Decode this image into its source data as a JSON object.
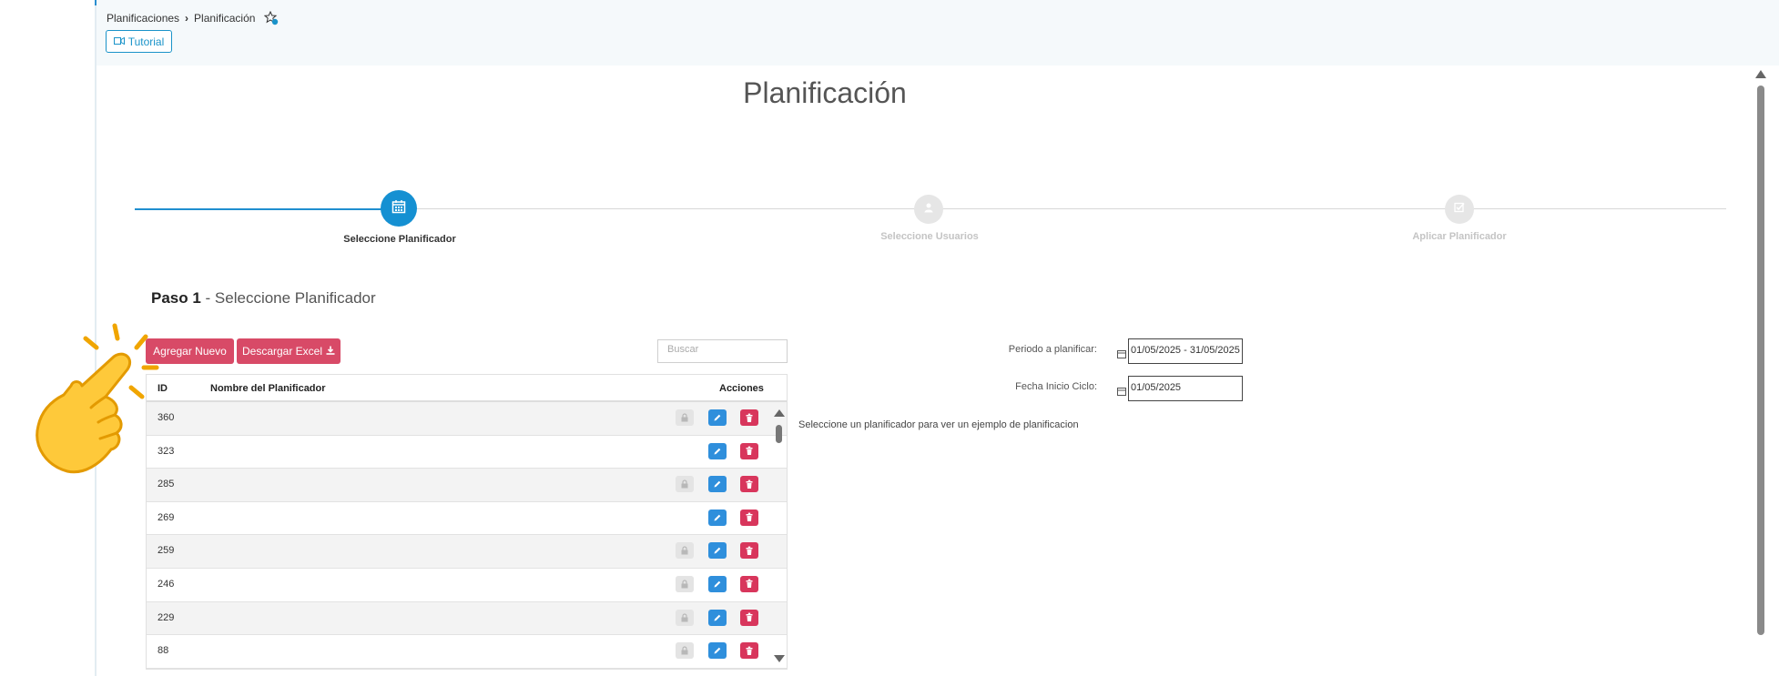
{
  "breadcrumb": {
    "parent": "Planificaciones",
    "current": "Planificación"
  },
  "tutorial_label": "Tutorial",
  "page_title": "Planificación",
  "steps": [
    {
      "label": "Seleccione Planificador",
      "state": "active",
      "icon": "calendar-icon"
    },
    {
      "label": "Seleccione Usuarios",
      "state": "inactive",
      "icon": "user-icon"
    },
    {
      "label": "Aplicar Planificador",
      "state": "inactive",
      "icon": "check-square-icon"
    }
  ],
  "paso": {
    "prefix": "Paso 1",
    "rest": " - Seleccione Planificador"
  },
  "buttons": {
    "add_new": "Agregar Nuevo",
    "download_excel": "Descargar Excel"
  },
  "search": {
    "placeholder": "Buscar"
  },
  "table": {
    "headers": {
      "id": "ID",
      "name": "Nombre del Planificador",
      "actions": "Acciones"
    },
    "rows": [
      {
        "id": "360",
        "name": "",
        "locked": true
      },
      {
        "id": "323",
        "name": "",
        "locked": false
      },
      {
        "id": "285",
        "name": "",
        "locked": true
      },
      {
        "id": "269",
        "name": "",
        "locked": false
      },
      {
        "id": "259",
        "name": "",
        "locked": true
      },
      {
        "id": "246",
        "name": "",
        "locked": true
      },
      {
        "id": "229",
        "name": "",
        "locked": true
      },
      {
        "id": "88",
        "name": "",
        "locked": true
      }
    ]
  },
  "form": {
    "periodo_label": "Periodo a planificar:",
    "periodo_value": "01/05/2025 - 31/05/2025",
    "fecha_label": "Fecha Inicio Ciclo:",
    "fecha_value": "01/05/2025"
  },
  "hint": "Seleccione un planificador para ver un ejemplo de planificacion",
  "colors": {
    "accent": "#1590d2",
    "danger": "#d84a67",
    "edit": "#2f8fdc",
    "delete": "#d8365c"
  }
}
